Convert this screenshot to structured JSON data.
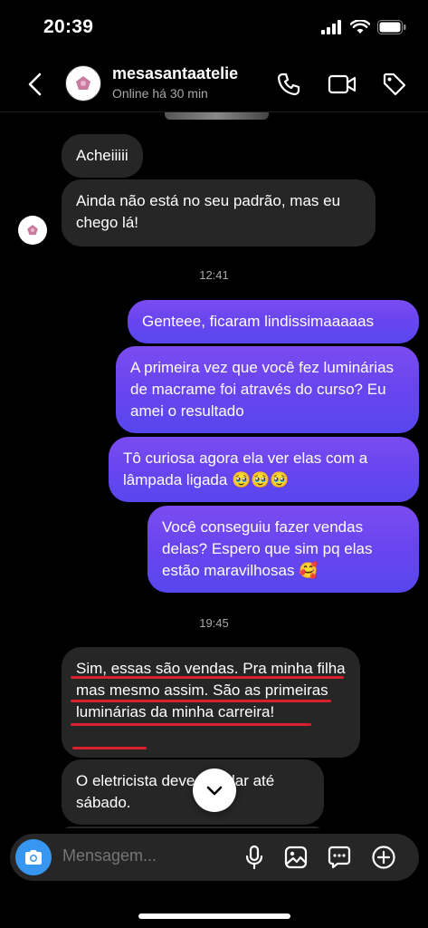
{
  "status_bar": {
    "time": "20:39"
  },
  "header": {
    "contact_name": "mesasantaatelie",
    "contact_status": "Online há 30 min"
  },
  "messages": {
    "recv_1": "Acheiiiii",
    "recv_2": "Ainda não está no seu padrão,  mas eu chego lá!",
    "time_1": "12:41",
    "sent_1": "Genteee, ficaram lindissimaaaaas",
    "sent_2": "A primeira vez que você fez luminárias de macrame foi através do curso? Eu amei o resultado",
    "sent_3": "Tô curiosa agora ela ver elas com a lâmpada ligada 🥹🥹🥹",
    "sent_4": "Você conseguiu fazer vendas delas? Espero que sim pq elas estão maravilhosas 🥰",
    "time_2": "19:45",
    "recv_3": "Sim, essas são vendas. Pra minha filha mas mesmo assim. São as primeiras luminárias da minha carreira!",
    "recv_4": "O eletricista deve instalar até sábado."
  },
  "composer": {
    "placeholder": "Mensagem..."
  },
  "colors": {
    "accent": "#3797f0",
    "sent_bubble": "#6a45ef",
    "received_bubble": "#262626",
    "underline": "#d8202e"
  },
  "icons": [
    "back-icon",
    "phone-icon",
    "video-icon",
    "tag-icon",
    "camera-icon",
    "mic-icon",
    "gallery-icon",
    "sticker-icon",
    "plus-icon",
    "chevron-down-icon"
  ]
}
